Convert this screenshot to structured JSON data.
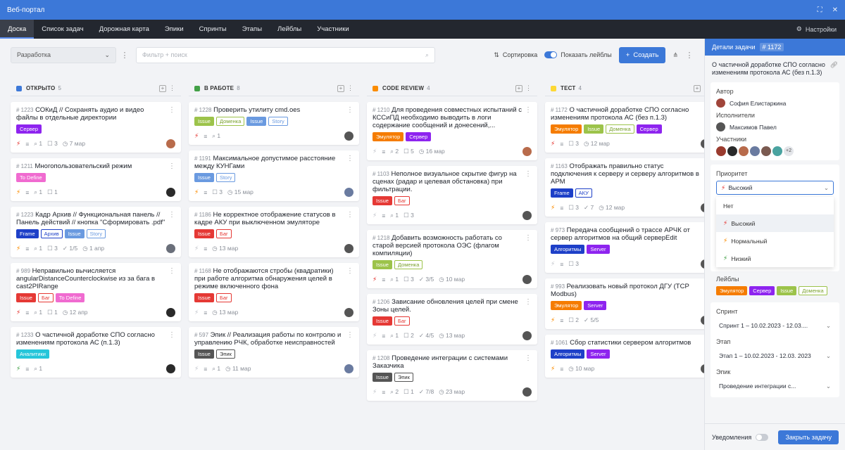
{
  "window": {
    "title": "Веб-портал"
  },
  "nav": {
    "items": [
      "Доска",
      "Список задач",
      "Дорожная карта",
      "Эпики",
      "Спринты",
      "Этапы",
      "Лейблы",
      "Участники"
    ],
    "active": 0,
    "settings": "Настройки"
  },
  "toolbar": {
    "project": "Разработка",
    "filter_placeholder": "Фильтр + поиск",
    "sort": "Сортировка",
    "show_labels": "Показать лейблы",
    "create": "Создать"
  },
  "colors": {
    "accent": "#3c78d8",
    "prio_high": "#e53935",
    "prio_normal": "#fb8c00",
    "prio_low": "#43a047",
    "server": "#8e24ef",
    "emulator": "#f57c00",
    "frame": "#1e40c8",
    "analytics": "#26c6da"
  },
  "columns": [
    {
      "name": "ОТКРЫТО",
      "count": "5",
      "color": "#3c78d8",
      "cards": [
        {
          "id": "# 1223",
          "title": "СОКиД // Сохранять аудио и видео файлы в отдельные директории",
          "tags": [
            {
              "t": "Сервер",
              "k": "server"
            }
          ],
          "prio": "high",
          "sub": "1",
          "comments": "3",
          "date": "7 мар",
          "avatar": "#b86b4b"
        },
        {
          "id": "# 1211",
          "title": "Многопользовательский режим",
          "tags": [
            {
              "t": "To Define",
              "k": "todefine"
            }
          ],
          "prio": "normal",
          "sub": "1",
          "comments": "1",
          "avatar": "#2a2a2a"
        },
        {
          "id": "# 1223",
          "title": "Кадр Архив // Функциональная панель // Панель действий // кнопка \"Сформировать .pdf\"",
          "tags": [
            {
              "t": "Frame",
              "k": "frame"
            },
            {
              "t": "Архив",
              "k": "frame-o"
            },
            {
              "t": "Issue",
              "k": "issue-b"
            },
            {
              "t": "Story",
              "k": "story-b"
            }
          ],
          "prio": "normal",
          "sub": "1",
          "comments": "3",
          "checks": "1/5",
          "date": "1 апр",
          "avatar": "#6a6f7a"
        },
        {
          "id": "# 989",
          "title": "Неправильно вычисляется angularDistanceCounterclockwise из за бага в cast2PIRange",
          "tags": [
            {
              "t": "Issue",
              "k": "issue-r"
            },
            {
              "t": "Баг",
              "k": "bug-r"
            },
            {
              "t": "To Define",
              "k": "todefine"
            }
          ],
          "prio": "high",
          "sub": "1",
          "comments": "1",
          "date": "12 апр",
          "avatar": "#2a2a2a"
        },
        {
          "id": "# 1233",
          "title": "О частичной доработке СПО согласно изменениям протокола АС (п.1.3)",
          "tags": [
            {
              "t": "Аналитики",
              "k": "analytics"
            }
          ],
          "prio": "low",
          "sub": "1",
          "avatar": "#2a2a2a"
        }
      ]
    },
    {
      "name": "В РАБОТЕ",
      "count": "8",
      "color": "#43a047",
      "cards": [
        {
          "id": "# 1228",
          "title": "Проверить утилиту cmd.oes",
          "tags": [
            {
              "t": "Issue",
              "k": "issue-g"
            },
            {
              "t": "Доменка",
              "k": "dom-g"
            },
            {
              "t": "Issue",
              "k": "issue-b"
            },
            {
              "t": "Story",
              "k": "story-b"
            }
          ],
          "prio": "high",
          "sub": "1",
          "avatar": "#555"
        },
        {
          "id": "# 1191",
          "title": "Максимальное допустимое расстояние между КУНГами",
          "tags": [
            {
              "t": "Issue",
              "k": "issue-b"
            },
            {
              "t": "Story",
              "k": "story-b"
            }
          ],
          "prio": "normal",
          "comments": "3",
          "date": "15 мар",
          "avatar": "#6a7ba0"
        },
        {
          "id": "# 1186",
          "title": "Не корректное отображение статусов в кадре АКУ при выключенном эмуляторе",
          "tags": [
            {
              "t": "Issue",
              "k": "issue-r"
            },
            {
              "t": "Баг",
              "k": "bug-r"
            }
          ],
          "prio": "none",
          "date": "13 мар",
          "avatar": "#555"
        },
        {
          "id": "# 1168",
          "title": "Не отображаются стробы (квадратики) при работе алгоритма обнаружения целей в режиме включенного фона",
          "tags": [
            {
              "t": "Issue",
              "k": "issue-r"
            },
            {
              "t": "Баг",
              "k": "bug-r"
            }
          ],
          "prio": "none",
          "date": "13 мар",
          "avatar": "#555"
        },
        {
          "id": "# 597",
          "title": "Эпик // Реализация работы по контролю и управлению РЧК, обработке неисправностей",
          "tags": [
            {
              "t": "Issue",
              "k": "issue-d"
            },
            {
              "t": "Эпик",
              "k": "epic-d"
            }
          ],
          "prio": "none",
          "sub": "1",
          "date": "11 мар",
          "avatar": "#6a7ba0"
        }
      ]
    },
    {
      "name": "CODE REVIEW",
      "count": "4",
      "color": "#fb8c00",
      "cards": [
        {
          "id": "# 1210",
          "title": "Для проведения совместных испытаний с КССиПД необходимо выводить в логи содержание сообщений и донесений,...",
          "tags": [
            {
              "t": "Эмулятор",
              "k": "emulator"
            },
            {
              "t": "Сервер",
              "k": "server"
            }
          ],
          "prio": "none",
          "sub": "2",
          "comments": "5",
          "date": "16 мар",
          "avatar": "#b86b4b"
        },
        {
          "id": "# 1103",
          "title": "Неполное визуальное скрытие фигур на сценах (радар и целевая обстановка) при фильтрации.",
          "tags": [
            {
              "t": "Issue",
              "k": "issue-r"
            },
            {
              "t": "Баг",
              "k": "bug-r"
            }
          ],
          "prio": "none",
          "sub": "1",
          "comments": "3",
          "avatar": "#555"
        },
        {
          "id": "# 1218",
          "title": "Добавить возможность работать со старой версией протокола ОЭС (флагом компиляции)",
          "tags": [
            {
              "t": "Issue",
              "k": "issue-g"
            },
            {
              "t": "Доменка",
              "k": "dom-g"
            }
          ],
          "prio": "high",
          "sub": "1",
          "comments": "3",
          "checks": "3/5",
          "date": "10 мар",
          "avatar": "#555"
        },
        {
          "id": "# 1206",
          "title": "Зависание обновления целей при смене Зоны целей.",
          "tags": [
            {
              "t": "Issue",
              "k": "issue-r"
            },
            {
              "t": "Баг",
              "k": "bug-r"
            }
          ],
          "prio": "none",
          "sub": "1",
          "comments": "2",
          "checks": "4/5",
          "date": "13 мар",
          "avatar": "#555"
        },
        {
          "id": "# 1208",
          "title": "Проведение интеграции с системами Заказчика",
          "tags": [
            {
              "t": "Issue",
              "k": "issue-d"
            },
            {
              "t": "Эпик",
              "k": "epic-d"
            }
          ],
          "prio": "none",
          "sub": "2",
          "comments": "1",
          "checks": "7/8",
          "date": "23 мар",
          "avatar": "#555"
        }
      ]
    },
    {
      "name": "ТЕСТ",
      "count": "4",
      "color": "#fdd835",
      "cards": [
        {
          "id": "# 1172",
          "title": "О частичной доработке СПО согласно изменениям протокола АС (без п.1.3)",
          "tags": [
            {
              "t": "Эмулятор",
              "k": "emulator"
            },
            {
              "t": "Issue",
              "k": "issue-g"
            },
            {
              "t": "Доменка",
              "k": "dom-g"
            },
            {
              "t": "Сервер",
              "k": "server"
            }
          ],
          "prio": "high",
          "comments": "3",
          "date": "12 мар",
          "avatar": "#555"
        },
        {
          "id": "# 1163",
          "title": "Отображать правильно статус подключения к серверу и серверу алгоритмов в АРМ",
          "tags": [
            {
              "t": "Frame",
              "k": "frame"
            },
            {
              "t": "АКУ",
              "k": "frame-o"
            }
          ],
          "prio": "normal",
          "comments": "3",
          "checks": "7",
          "date": "12 мар",
          "avatar": "#555"
        },
        {
          "id": "# 973",
          "title": "Передача сообщений о трассе АРЧК от сервер алгоритмов на общий серверEdit",
          "tags": [
            {
              "t": "Алгоритмы",
              "k": "frame"
            },
            {
              "t": "Server",
              "k": "server"
            }
          ],
          "prio": "none",
          "comments": "3",
          "avatar": "#555"
        },
        {
          "id": "# 993",
          "title": "Реализовать новый протокол ДГУ (TCP Modbus)",
          "tags": [
            {
              "t": "Эмулятор",
              "k": "emulator"
            },
            {
              "t": "Server",
              "k": "server"
            }
          ],
          "prio": "normal",
          "comments": "2",
          "checks": "5/5",
          "avatar": "#555"
        },
        {
          "id": "# 1061",
          "title": "Сбор статистики сервером алгоритмов",
          "tags": [
            {
              "t": "Алгоритмы",
              "k": "frame"
            },
            {
              "t": "Server",
              "k": "server"
            }
          ],
          "prio": "normal",
          "date": "10 мар",
          "avatar": "#555"
        }
      ]
    }
  ],
  "panel": {
    "header": "Детали задачи",
    "number": "# 1172",
    "title": "О частичной доработке СПО согласно изменениям протокола АС (без п.1.3)",
    "author_label": "Автор",
    "author": "София Елистаркина",
    "assignee_label": "Исполнители",
    "assignee": "Максимов Павел",
    "participants_label": "Участники",
    "participants_more": "+2",
    "priority_label": "Приоритет",
    "priority_value": "Высокий",
    "priority_options": [
      {
        "t": "Нет",
        "k": "none"
      },
      {
        "t": "Высокий",
        "k": "high"
      },
      {
        "t": "Нормальный",
        "k": "normal"
      },
      {
        "t": "Низкий",
        "k": "low"
      }
    ],
    "labels_label": "Лейблы",
    "labels": [
      {
        "t": "Эмулятор",
        "k": "emulator"
      },
      {
        "t": "Сервер",
        "k": "server"
      },
      {
        "t": "Issue",
        "k": "issue-g"
      },
      {
        "t": "Доменка",
        "k": "dom-g"
      }
    ],
    "sprint_label": "Спринт",
    "sprint_value": "Спринт 1 – 10.02.2023 - 12.03....",
    "stage_label": "Этап",
    "stage_value": "Этап 1 – 10.02.2023 - 12.03. 2023",
    "epic_label": "Эпик",
    "epic_value": "Проведение интеграции с...",
    "notifications": "Уведомления",
    "close": "Закрыть задачу"
  }
}
